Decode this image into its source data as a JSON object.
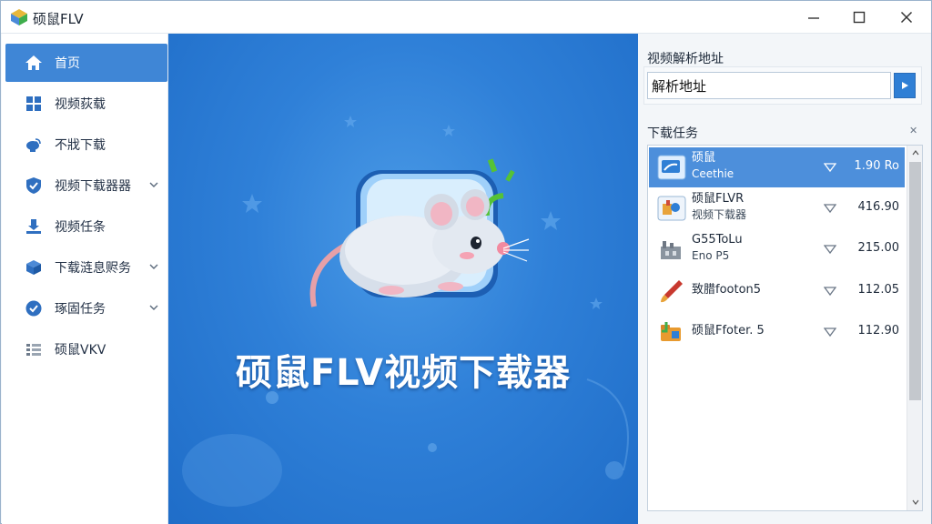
{
  "window": {
    "title": "硕鼠FLV",
    "minimize_label": "─",
    "maximize_label": "☐",
    "close_label": "✕"
  },
  "sidebar": {
    "items": [
      {
        "label": "首页",
        "icon": "home-icon",
        "active": true,
        "expandable": false
      },
      {
        "label": "视频荻载",
        "icon": "grid-icon",
        "active": false,
        "expandable": false
      },
      {
        "label": "不戕下载",
        "icon": "satellite-icon",
        "active": false,
        "expandable": false
      },
      {
        "label": "视频下载器器",
        "icon": "shield-check-icon",
        "active": false,
        "expandable": true
      },
      {
        "label": "视频任条",
        "icon": "download-tray-icon",
        "active": false,
        "expandable": false
      },
      {
        "label": "下载涟息赆务",
        "icon": "box-icon",
        "active": false,
        "expandable": true
      },
      {
        "label": "琢固任务",
        "icon": "check-circle-icon",
        "active": false,
        "expandable": true
      },
      {
        "label": "硕鼠VKV",
        "icon": "list-icon",
        "active": false,
        "expandable": false
      }
    ]
  },
  "hero": {
    "title": "硕鼠FLV视频下载器"
  },
  "right_panel": {
    "url_label": "视频解析地址",
    "url_value": "解析地址",
    "tasks_label": "下载任务",
    "pin_label": "✕",
    "tasks": [
      {
        "name": "硕鼠",
        "sub": "Ceethie",
        "size": "1.90 Ro",
        "selected": true,
        "icon": "video-file-icon"
      },
      {
        "name": "硕鼠FLVR",
        "sub": "视频下载器",
        "size": "416.90",
        "selected": false,
        "icon": "puzzle-icon"
      },
      {
        "name": "G55ToLu",
        "sub": "Eno P5",
        "size": "215.00",
        "selected": false,
        "icon": "factory-icon"
      },
      {
        "name": "致腊footon5",
        "sub": "",
        "size": "112.05",
        "selected": false,
        "icon": "brush-icon"
      },
      {
        "name": "硕鼠Ffoter. 5",
        "sub": "",
        "size": "112.90",
        "selected": false,
        "icon": "folder-arrow-icon"
      }
    ]
  },
  "colors": {
    "accent": "#3f86d6",
    "hero_bg": "#2f80d8",
    "selected_row": "#4d8fdb"
  }
}
